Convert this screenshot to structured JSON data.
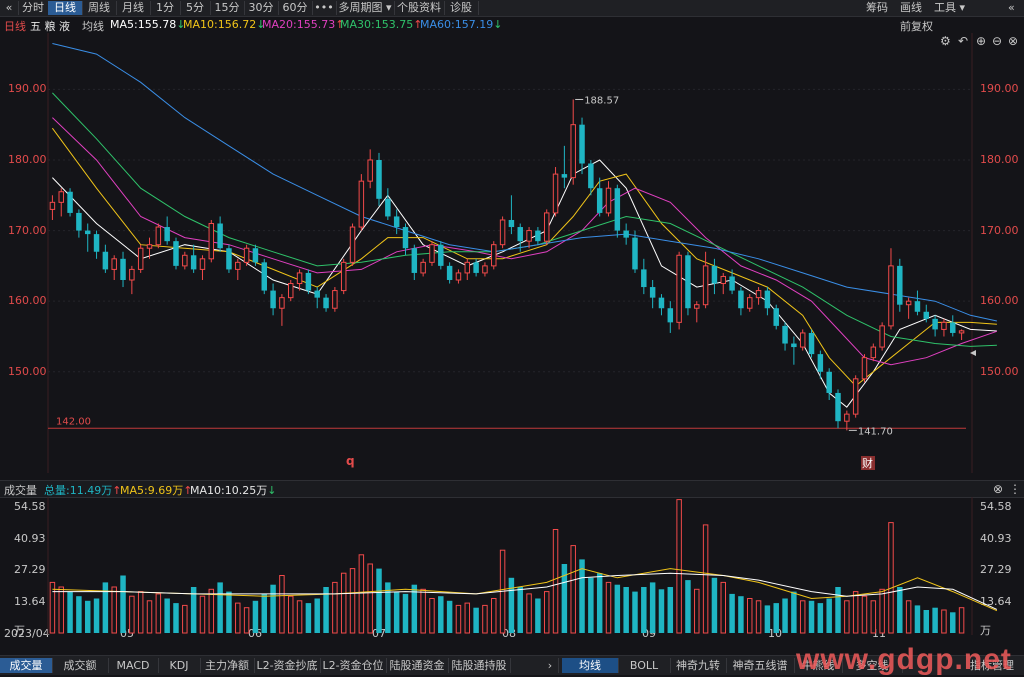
{
  "toolbar": {
    "back_icon": "double-chevron-left-icon",
    "tabs": [
      {
        "label": "分时",
        "active": false
      },
      {
        "label": "日线",
        "active": true
      },
      {
        "label": "周线",
        "active": false
      },
      {
        "label": "月线",
        "active": false
      },
      {
        "label": "1分",
        "active": false
      },
      {
        "label": "5分",
        "active": false
      },
      {
        "label": "15分",
        "active": false
      },
      {
        "label": "30分",
        "active": false
      },
      {
        "label": "60分",
        "active": false
      },
      {
        "label": "•••",
        "active": false
      },
      {
        "label": "多周期图 ▾",
        "active": false
      },
      {
        "label": "个股资料",
        "active": false
      },
      {
        "label": "诊股",
        "active": false
      }
    ],
    "right": {
      "chip": "筹码",
      "draw": "画线",
      "tools": "工具 ▾",
      "collapse": "«"
    }
  },
  "legend": {
    "period": "日线",
    "stock": "五 粮 液",
    "avg_line": "均线",
    "ma": [
      {
        "text": "MA5:155.78",
        "dir": "down",
        "color": "#ffffff"
      },
      {
        "text": "MA10:156.72",
        "dir": "down",
        "color": "#f0c419"
      },
      {
        "text": "MA20:155.73",
        "dir": "up",
        "color": "#e040c0"
      },
      {
        "text": "MA30:153.75",
        "dir": "up",
        "color": "#2fc26a"
      },
      {
        "text": "MA60:157.19",
        "dir": "down",
        "color": "#3a8ee6"
      }
    ],
    "right_label": "前复权"
  },
  "price_axis": {
    "ticks": [
      "190.00",
      "180.00",
      "170.00",
      "160.00",
      "150.00"
    ]
  },
  "annotations": {
    "high": "188.57",
    "low": "141.70",
    "support": "142.00",
    "q_marker": "q",
    "cai_marker": "财"
  },
  "volume": {
    "title": "成交量",
    "total": "总量:11.49万",
    "ma5": "MA5:9.69万",
    "ma10": "MA10:10.25万",
    "ticks": [
      "54.58",
      "40.93",
      "27.29",
      "13.64",
      "万"
    ]
  },
  "dates": [
    "2023/04",
    "05",
    "06",
    "07",
    "08",
    "09",
    "10",
    "11"
  ],
  "bottom_tabs_left": [
    "成交量",
    "成交额",
    "MACD",
    "KDJ",
    "主力净额",
    "L2-资金抄底",
    "L2-资金仓位",
    "陆股通资金",
    "陆股通持股"
  ],
  "bottom_tabs_right": [
    "均线",
    "BOLL",
    "神奇九转",
    "神奇五线谱",
    "牛熊线",
    "多空线",
    "指标管理"
  ],
  "watermark": "www.gdgp.net",
  "colors": {
    "up": "#f24a4a",
    "down": "#1fb5c3",
    "ma5": "#ffffff",
    "ma10": "#f0c419",
    "ma20": "#e040c0",
    "ma30": "#2fc26a",
    "ma60": "#3a8ee6",
    "accent": "#2b5c95"
  },
  "chart_data": {
    "type": "candlestick",
    "price_range": [
      138,
      198
    ],
    "volume_range": [
      0,
      60
    ],
    "candles": [
      [
        173,
        175,
        171.5,
        174,
        22
      ],
      [
        174,
        176,
        172,
        175.5,
        20
      ],
      [
        175.5,
        176,
        172,
        172.5,
        18
      ],
      [
        172.5,
        173,
        169,
        170,
        16
      ],
      [
        170,
        171,
        167,
        169.5,
        14
      ],
      [
        169.5,
        170,
        166,
        167,
        15
      ],
      [
        167,
        168,
        164,
        164.5,
        22
      ],
      [
        164.5,
        166.5,
        163,
        166,
        20
      ],
      [
        166,
        167,
        162,
        163,
        25
      ],
      [
        163,
        165,
        161,
        164.5,
        16
      ],
      [
        164.5,
        168,
        164,
        167.5,
        18
      ],
      [
        167.5,
        169,
        166,
        168,
        14
      ],
      [
        168,
        171,
        167.5,
        170.5,
        17
      ],
      [
        170.5,
        172,
        168,
        168.5,
        15
      ],
      [
        168.5,
        169,
        164.5,
        165,
        13
      ],
      [
        165,
        167,
        164.5,
        166.5,
        12
      ],
      [
        166.5,
        168,
        164,
        164.5,
        20
      ],
      [
        164.5,
        166.5,
        163,
        166,
        16
      ],
      [
        166,
        171.5,
        165.5,
        171,
        19
      ],
      [
        171,
        172,
        167,
        167.5,
        22
      ],
      [
        167.5,
        168,
        164,
        164.5,
        18
      ],
      [
        164.5,
        166,
        163,
        165.5,
        13
      ],
      [
        165.5,
        168,
        165,
        167.5,
        11
      ],
      [
        167.5,
        168,
        165,
        165.5,
        14
      ],
      [
        165.5,
        166,
        161,
        161.5,
        17
      ],
      [
        161.5,
        162.5,
        158,
        159,
        21
      ],
      [
        159,
        161,
        156.5,
        160.5,
        25
      ],
      [
        160.5,
        163,
        160,
        162.5,
        16
      ],
      [
        162.5,
        164.5,
        161.5,
        164,
        14
      ],
      [
        164,
        164.5,
        161,
        161.5,
        13
      ],
      [
        161.5,
        162,
        159,
        160.5,
        15
      ],
      [
        160.5,
        161,
        158.5,
        159,
        20
      ],
      [
        159,
        162,
        158.5,
        161.5,
        22
      ],
      [
        161.5,
        166,
        161,
        165.5,
        26
      ],
      [
        165.5,
        171,
        165,
        170.5,
        28
      ],
      [
        170.5,
        178,
        170,
        177,
        34
      ],
      [
        177,
        181.5,
        176,
        180,
        30
      ],
      [
        180,
        181,
        173.5,
        174.5,
        28
      ],
      [
        174.5,
        176,
        171.5,
        172,
        22
      ],
      [
        172,
        173,
        169.5,
        170.5,
        18
      ],
      [
        170.5,
        171,
        166.5,
        167.5,
        17
      ],
      [
        167.5,
        168,
        163,
        164,
        21
      ],
      [
        164,
        166,
        163.5,
        165.5,
        19
      ],
      [
        165.5,
        168.5,
        165,
        168,
        15
      ],
      [
        168,
        168.5,
        164.5,
        165,
        16
      ],
      [
        165,
        165.5,
        162.5,
        163,
        14
      ],
      [
        163,
        164.5,
        162.5,
        164,
        12
      ],
      [
        164,
        166,
        163,
        165.5,
        13
      ],
      [
        165.5,
        166,
        163.5,
        164,
        11
      ],
      [
        164,
        165.5,
        163.5,
        165,
        12
      ],
      [
        165,
        168.5,
        164.5,
        168,
        15
      ],
      [
        168,
        172,
        167.5,
        171.5,
        36
      ],
      [
        171.5,
        175,
        169.5,
        170.5,
        24
      ],
      [
        170.5,
        171,
        167,
        168.5,
        20
      ],
      [
        168.5,
        170.5,
        167.5,
        170,
        17
      ],
      [
        170,
        170.5,
        168,
        168.5,
        15
      ],
      [
        168.5,
        173,
        168,
        172.5,
        18
      ],
      [
        172.5,
        179,
        172,
        178,
        45
      ],
      [
        178,
        182,
        176,
        177.5,
        30
      ],
      [
        177.5,
        188.57,
        176.5,
        185,
        38
      ],
      [
        185,
        186,
        178,
        179.5,
        32
      ],
      [
        179.5,
        180,
        175,
        176,
        24
      ],
      [
        176,
        177.5,
        172,
        172.5,
        26
      ],
      [
        172.5,
        177,
        172,
        176,
        22
      ],
      [
        176,
        176.5,
        169,
        170,
        21
      ],
      [
        170,
        171,
        168,
        169,
        20
      ],
      [
        169,
        170,
        164,
        164.5,
        18
      ],
      [
        164.5,
        166,
        161,
        162,
        20
      ],
      [
        162,
        163,
        159,
        160.5,
        22
      ],
      [
        160.5,
        161,
        158,
        159,
        19
      ],
      [
        159,
        160,
        155.5,
        157,
        20
      ],
      [
        157,
        167,
        156,
        166.5,
        58
      ],
      [
        166.5,
        167,
        158,
        159,
        23
      ],
      [
        159,
        160,
        157,
        159.5,
        19
      ],
      [
        159.5,
        167,
        159,
        165,
        47
      ],
      [
        165,
        166,
        161,
        162.5,
        24
      ],
      [
        162.5,
        164,
        161,
        163.5,
        22
      ],
      [
        163.5,
        164.5,
        161,
        161.5,
        17
      ],
      [
        161.5,
        162,
        158,
        159,
        16
      ],
      [
        159,
        161,
        158.5,
        160.5,
        15
      ],
      [
        160.5,
        162,
        159.5,
        161.5,
        14
      ],
      [
        161.5,
        162,
        158,
        159,
        12
      ],
      [
        159,
        159.5,
        156,
        156.5,
        13
      ],
      [
        156.5,
        157,
        153,
        154,
        15
      ],
      [
        154,
        155,
        151,
        153.5,
        18
      ],
      [
        153.5,
        156,
        153,
        155.5,
        14
      ],
      [
        155.5,
        156,
        152,
        152.5,
        14
      ],
      [
        152.5,
        153,
        149,
        150,
        13
      ],
      [
        150,
        150.5,
        146,
        147,
        15
      ],
      [
        147,
        147.5,
        142,
        143,
        20
      ],
      [
        143,
        144.5,
        141.7,
        144,
        14
      ],
      [
        144,
        149.5,
        143.5,
        149,
        18
      ],
      [
        149,
        152.5,
        148.5,
        152,
        16
      ],
      [
        152,
        154,
        151.5,
        153.5,
        14
      ],
      [
        153.5,
        157,
        153,
        156.5,
        19
      ],
      [
        156.5,
        167.5,
        156,
        165,
        48
      ],
      [
        165,
        166,
        158.5,
        159.5,
        20
      ],
      [
        159.5,
        160.5,
        157.5,
        160,
        14
      ],
      [
        160,
        161.5,
        158,
        158.5,
        12
      ],
      [
        158.5,
        159.5,
        157,
        157.5,
        10
      ],
      [
        157.5,
        158,
        155,
        156,
        11
      ],
      [
        156,
        157.5,
        155,
        157,
        10
      ],
      [
        157,
        158,
        155,
        155.5,
        9
      ],
      [
        155.5,
        156,
        154.5,
        155.8,
        11
      ]
    ],
    "ma_lines": {
      "MA5": [
        [
          0,
          177.5
        ],
        [
          5,
          171
        ],
        [
          10,
          166
        ],
        [
          15,
          168
        ],
        [
          20,
          167
        ],
        [
          25,
          163
        ],
        [
          30,
          161
        ],
        [
          35,
          170
        ],
        [
          38,
          175
        ],
        [
          42,
          168
        ],
        [
          47,
          165
        ],
        [
          51,
          167
        ],
        [
          56,
          170
        ],
        [
          59,
          178
        ],
        [
          62,
          180
        ],
        [
          65,
          176
        ],
        [
          69,
          165
        ],
        [
          73,
          162
        ],
        [
          77,
          163
        ],
        [
          81,
          160
        ],
        [
          85,
          154
        ],
        [
          88,
          147
        ],
        [
          90,
          145
        ],
        [
          93,
          150
        ],
        [
          96,
          156
        ],
        [
          100,
          158
        ],
        [
          104,
          156
        ],
        [
          107,
          155.78
        ]
      ],
      "MA10": [
        [
          0,
          184.5
        ],
        [
          5,
          176
        ],
        [
          10,
          168
        ],
        [
          15,
          167.5
        ],
        [
          20,
          167
        ],
        [
          25,
          164.5
        ],
        [
          30,
          162
        ],
        [
          35,
          166
        ],
        [
          38,
          169
        ],
        [
          42,
          169
        ],
        [
          47,
          166
        ],
        [
          51,
          166
        ],
        [
          56,
          168
        ],
        [
          59,
          172
        ],
        [
          62,
          177
        ],
        [
          65,
          178
        ],
        [
          69,
          171
        ],
        [
          73,
          166
        ],
        [
          77,
          164
        ],
        [
          81,
          162
        ],
        [
          85,
          158
        ],
        [
          88,
          152
        ],
        [
          91,
          148
        ],
        [
          94,
          151
        ],
        [
          97,
          154
        ],
        [
          100,
          157
        ],
        [
          104,
          157
        ],
        [
          107,
          156.72
        ]
      ],
      "MA20": [
        [
          0,
          186
        ],
        [
          5,
          180
        ],
        [
          10,
          172
        ],
        [
          15,
          169
        ],
        [
          20,
          168
        ],
        [
          25,
          166
        ],
        [
          30,
          164
        ],
        [
          35,
          164.5
        ],
        [
          39,
          167
        ],
        [
          43,
          168
        ],
        [
          48,
          167
        ],
        [
          52,
          166
        ],
        [
          56,
          167
        ],
        [
          60,
          170
        ],
        [
          63,
          174
        ],
        [
          66,
          176
        ],
        [
          70,
          174
        ],
        [
          74,
          169
        ],
        [
          78,
          165
        ],
        [
          82,
          163
        ],
        [
          86,
          160
        ],
        [
          89,
          156
        ],
        [
          92,
          152
        ],
        [
          95,
          151
        ],
        [
          99,
          152
        ],
        [
          103,
          154
        ],
        [
          107,
          155.73
        ]
      ],
      "MA30": [
        [
          0,
          189.5
        ],
        [
          5,
          183
        ],
        [
          10,
          176
        ],
        [
          15,
          172
        ],
        [
          20,
          169
        ],
        [
          25,
          167
        ],
        [
          30,
          165
        ],
        [
          35,
          165.5
        ],
        [
          40,
          166.5
        ],
        [
          45,
          167
        ],
        [
          50,
          167
        ],
        [
          55,
          168
        ],
        [
          60,
          170
        ],
        [
          65,
          172
        ],
        [
          70,
          171
        ],
        [
          75,
          168
        ],
        [
          80,
          165
        ],
        [
          85,
          162
        ],
        [
          90,
          158
        ],
        [
          95,
          155
        ],
        [
          100,
          154
        ],
        [
          104,
          153.6
        ],
        [
          107,
          153.75
        ]
      ],
      "MA60": [
        [
          0,
          196.5
        ],
        [
          5,
          195
        ],
        [
          10,
          191
        ],
        [
          15,
          186
        ],
        [
          20,
          182
        ],
        [
          25,
          178
        ],
        [
          30,
          175
        ],
        [
          35,
          172
        ],
        [
          40,
          170
        ],
        [
          45,
          168
        ],
        [
          50,
          167
        ],
        [
          55,
          168
        ],
        [
          60,
          169
        ],
        [
          65,
          169.5
        ],
        [
          70,
          168.5
        ],
        [
          75,
          167.5
        ],
        [
          80,
          166
        ],
        [
          85,
          164
        ],
        [
          90,
          162
        ],
        [
          95,
          161
        ],
        [
          100,
          160
        ],
        [
          104,
          158
        ],
        [
          107,
          157.19
        ]
      ]
    },
    "volume_ma": {
      "MA5": [
        [
          0,
          19
        ],
        [
          8,
          18
        ],
        [
          16,
          17
        ],
        [
          24,
          16
        ],
        [
          32,
          17
        ],
        [
          40,
          19
        ],
        [
          48,
          17
        ],
        [
          56,
          22
        ],
        [
          60,
          28
        ],
        [
          64,
          24
        ],
        [
          70,
          28
        ],
        [
          76,
          25
        ],
        [
          80,
          22
        ],
        [
          86,
          15
        ],
        [
          90,
          16
        ],
        [
          94,
          18
        ],
        [
          98,
          24
        ],
        [
          102,
          18
        ],
        [
          107,
          9.69
        ]
      ],
      "MA10": [
        [
          0,
          18
        ],
        [
          8,
          18
        ],
        [
          16,
          17
        ],
        [
          24,
          17
        ],
        [
          32,
          17
        ],
        [
          40,
          18
        ],
        [
          48,
          17
        ],
        [
          56,
          20
        ],
        [
          60,
          24
        ],
        [
          64,
          25
        ],
        [
          70,
          26
        ],
        [
          76,
          25
        ],
        [
          80,
          23
        ],
        [
          86,
          18
        ],
        [
          90,
          16
        ],
        [
          94,
          17
        ],
        [
          98,
          20
        ],
        [
          102,
          19
        ],
        [
          107,
          10.25
        ]
      ]
    }
  }
}
